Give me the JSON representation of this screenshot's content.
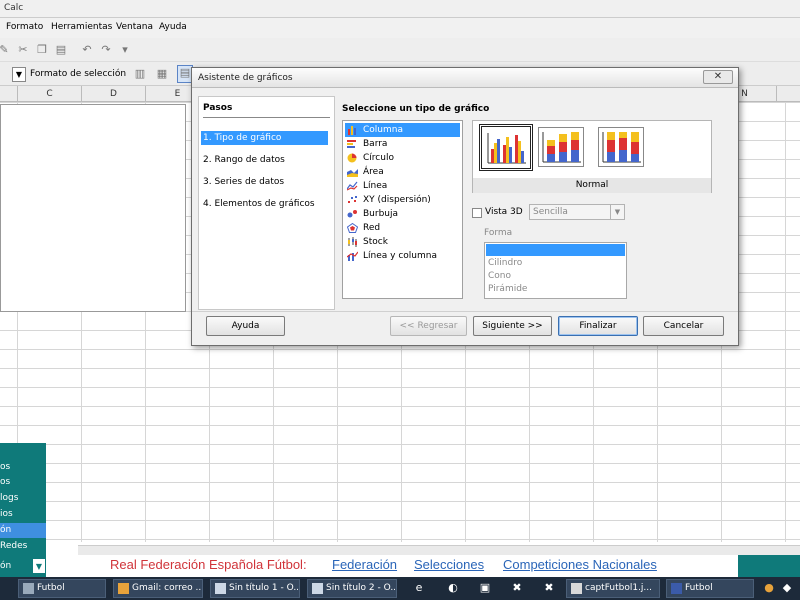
{
  "window": {
    "title": "Calc"
  },
  "menu": [
    {
      "label": "Formato"
    },
    {
      "label": "Herramientas"
    },
    {
      "label": "Ventana"
    },
    {
      "label": "Ayuda"
    }
  ],
  "toolbar2": {
    "selection_label": "Formato de selección"
  },
  "columns": [
    "C",
    "D",
    "E",
    "N"
  ],
  "dialog": {
    "title": "Asistente de gráficos",
    "close": "✕",
    "steps_title": "Pasos",
    "steps": [
      {
        "label": "1. Tipo de gráfico"
      },
      {
        "label": "2. Rango de datos"
      },
      {
        "label": "3. Series de datos"
      },
      {
        "label": "4. Elementos de gráficos"
      }
    ],
    "select_title": "Seleccione un tipo de gráfico",
    "chart_types": [
      {
        "label": "Columna",
        "icon": "column-chart-icon"
      },
      {
        "label": "Barra",
        "icon": "bar-chart-icon"
      },
      {
        "label": "Círculo",
        "icon": "pie-chart-icon"
      },
      {
        "label": "Área",
        "icon": "area-chart-icon"
      },
      {
        "label": "Línea",
        "icon": "line-chart-icon"
      },
      {
        "label": "XY (dispersión)",
        "icon": "scatter-chart-icon"
      },
      {
        "label": "Burbuja",
        "icon": "bubble-chart-icon"
      },
      {
        "label": "Red",
        "icon": "net-chart-icon"
      },
      {
        "label": "Stock",
        "icon": "stock-chart-icon"
      },
      {
        "label": "Línea y columna",
        "icon": "column-line-chart-icon"
      }
    ],
    "variant_label": "Normal",
    "vista3d_label": "Vista 3D",
    "style_value": "Sencilla",
    "forma_label": "Forma",
    "forma_items": [
      "",
      "Cilindro",
      "Cono",
      "Pirámide"
    ],
    "buttons": {
      "help": "Ayuda",
      "back": "<< Regresar",
      "next": "Siguiente >>",
      "finish": "Finalizar",
      "cancel": "Cancelar"
    }
  },
  "left_panel": {
    "items": [
      "os",
      "os",
      "logs",
      "ios",
      "ón",
      "Redes"
    ],
    "footer_label": "ón"
  },
  "footer": {
    "title": "Real Federación Española Fútbol:",
    "links": [
      "Federación",
      "Selecciones",
      "Competiciones Nacionales"
    ]
  },
  "taskbar": {
    "tasks": [
      "Futbol",
      "Gmail: correo ...",
      "Sin título 1 - O...",
      "Sin título 2 - O...",
      "captFutbol1.j...",
      "Futbol"
    ]
  },
  "colors": {
    "teal": "#0f7a7a",
    "selection": "#3399ff",
    "footer_title": "#d0343a",
    "footer_link": "#2a65b8"
  }
}
